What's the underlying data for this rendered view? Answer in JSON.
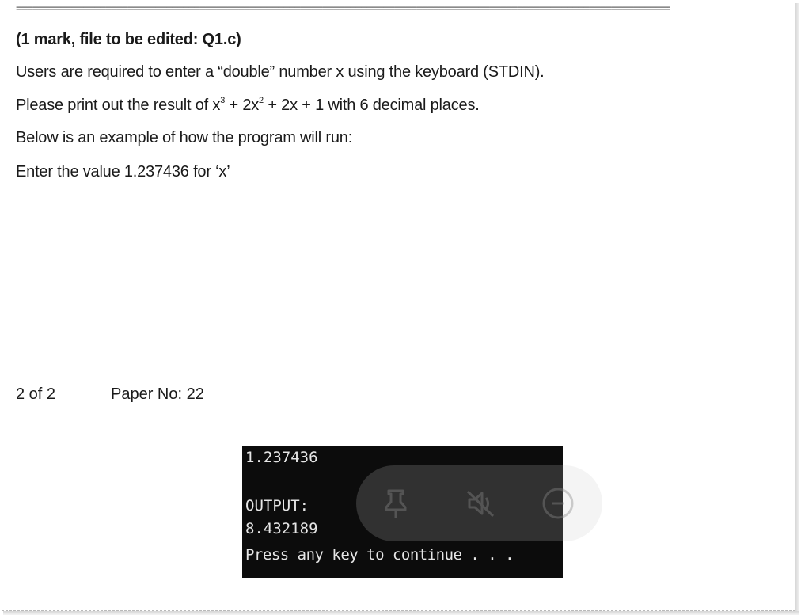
{
  "separator": "==========================================================================================================================",
  "question": {
    "heading": "(1 mark, file to be edited: Q1.c)",
    "line_input": "Users are required to enter a “double” number x using the keyboard (STDIN).",
    "formula": {
      "prefix": "Please print out the result of x",
      "exp3": "3",
      "mid1": " + 2x",
      "exp2": "2",
      "suffix": " + 2x + 1 with 6 decimal places."
    },
    "line_example_intro": "Below is an example of how the program will run:",
    "line_example_value": "Enter the value 1.237436 for ‘x’"
  },
  "footer": {
    "page": "2 of 2",
    "paper": "Paper No: 22"
  },
  "console": {
    "input": "1.237436",
    "output_label": "OUTPUT:",
    "output_value": "8.432189",
    "continue_prompt": "Press any key to continue . . ."
  },
  "overlay_controls": {
    "icons": [
      "pin-icon",
      "mute-icon",
      "minus-circle-icon"
    ]
  }
}
